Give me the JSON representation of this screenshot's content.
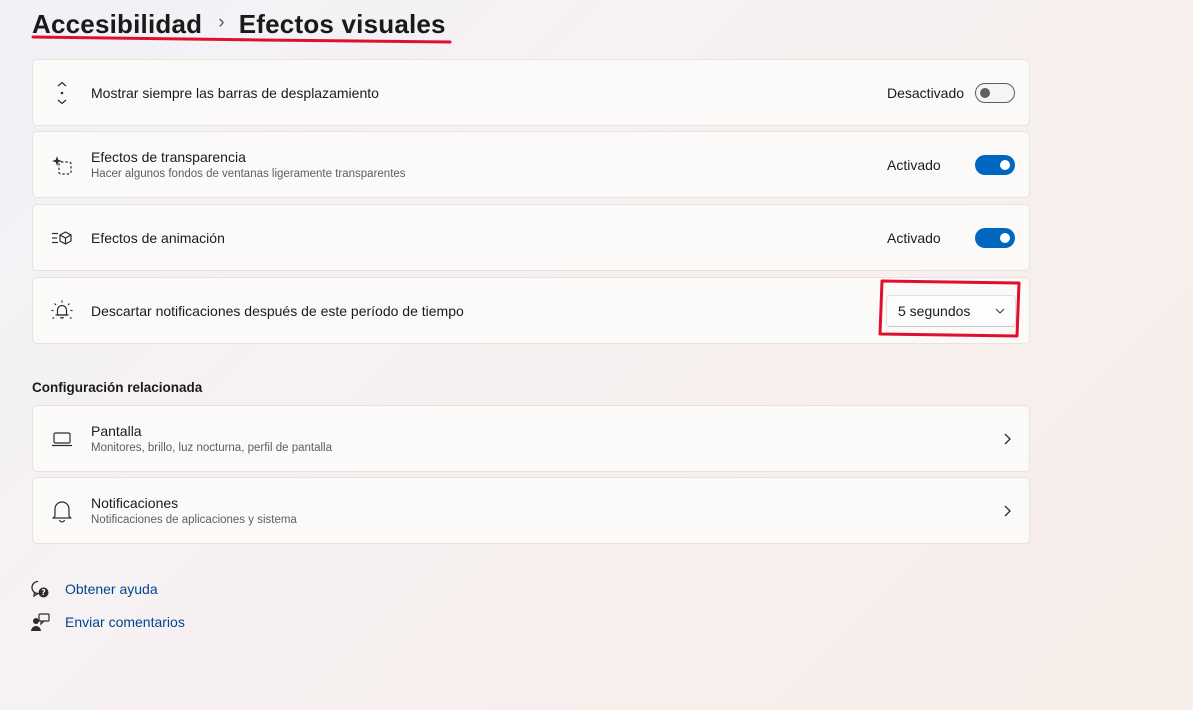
{
  "breadcrumb": {
    "parent": "Accesibilidad",
    "separator": "›",
    "current": "Efectos visuales"
  },
  "settings": [
    {
      "title": "Mostrar siempre las barras de desplazamiento",
      "state": "Desactivado",
      "toggle_on": false,
      "icon": "scrollbar-icon"
    },
    {
      "title": "Efectos de transparencia",
      "subtitle": "Hacer algunos fondos de ventanas ligeramente transparentes",
      "state": "Activado",
      "toggle_on": true,
      "icon": "transparency-icon"
    },
    {
      "title": "Efectos de animación",
      "state": "Activado",
      "toggle_on": true,
      "icon": "animation-icon"
    },
    {
      "title": "Descartar notificaciones después de este período de tiempo",
      "dropdown_value": "5 segundos",
      "icon": "notification-timer-icon"
    }
  ],
  "related": {
    "heading": "Configuración relacionada",
    "items": [
      {
        "title": "Pantalla",
        "subtitle": "Monitores, brillo, luz nocturna, perfil de pantalla",
        "icon": "display-icon"
      },
      {
        "title": "Notificaciones",
        "subtitle": "Notificaciones de aplicaciones y sistema",
        "icon": "bell-icon"
      }
    ]
  },
  "help_links": [
    {
      "label": "Obtener ayuda",
      "icon": "help-icon"
    },
    {
      "label": "Enviar comentarios",
      "icon": "feedback-icon"
    }
  ],
  "colors": {
    "accent": "#0067c0",
    "link": "#00468f",
    "annotation_red": "#e0102d"
  }
}
